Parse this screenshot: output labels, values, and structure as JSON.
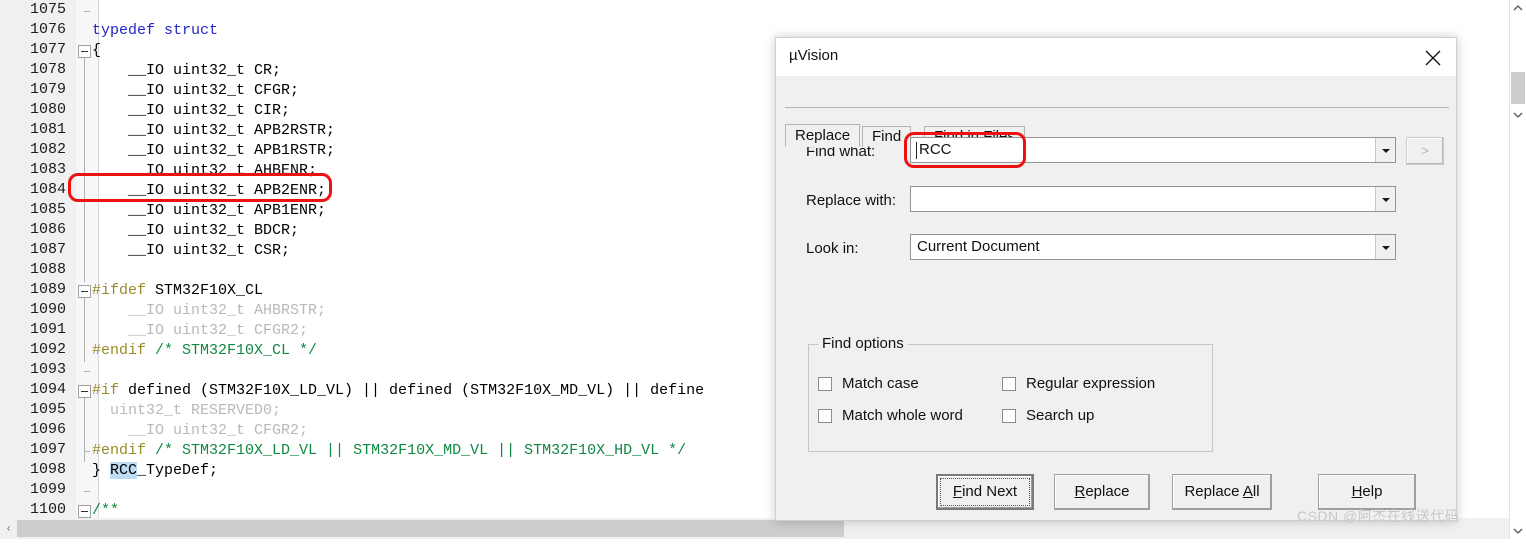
{
  "editor": {
    "lines": [
      {
        "num": "1075",
        "segments": [],
        "fold": "tick"
      },
      {
        "num": "1076",
        "segments": [
          {
            "t": "typedef struct",
            "c": "kw"
          }
        ]
      },
      {
        "num": "1077",
        "segments": [
          {
            "t": "{",
            "c": ""
          }
        ],
        "fold": "marker"
      },
      {
        "num": "1078",
        "segments": [
          {
            "t": "    __IO uint32_t CR;",
            "c": ""
          }
        ]
      },
      {
        "num": "1079",
        "segments": [
          {
            "t": "    __IO uint32_t CFGR;",
            "c": ""
          }
        ]
      },
      {
        "num": "1080",
        "segments": [
          {
            "t": "    __IO uint32_t CIR;",
            "c": ""
          }
        ]
      },
      {
        "num": "1081",
        "segments": [
          {
            "t": "    __IO uint32_t APB2RSTR;",
            "c": ""
          }
        ]
      },
      {
        "num": "1082",
        "segments": [
          {
            "t": "    __IO uint32_t APB1RSTR;",
            "c": ""
          }
        ]
      },
      {
        "num": "1083",
        "segments": [
          {
            "t": "    __IO uint32_t AHBENR;",
            "c": ""
          }
        ]
      },
      {
        "num": "1084",
        "segments": [
          {
            "t": "    __IO uint32_t APB2ENR;",
            "c": ""
          }
        ]
      },
      {
        "num": "1085",
        "segments": [
          {
            "t": "    __IO uint32_t APB1ENR;",
            "c": ""
          }
        ]
      },
      {
        "num": "1086",
        "segments": [
          {
            "t": "    __IO uint32_t BDCR;",
            "c": ""
          }
        ]
      },
      {
        "num": "1087",
        "segments": [
          {
            "t": "    __IO uint32_t CSR;",
            "c": ""
          }
        ]
      },
      {
        "num": "1088",
        "segments": []
      },
      {
        "num": "1089",
        "segments": [
          {
            "t": "#ifdef",
            "c": "pp"
          },
          {
            "t": " STM32F10X_CL",
            "c": ""
          }
        ],
        "fold": "marker"
      },
      {
        "num": "1090",
        "segments": [
          {
            "t": "    __IO uint32_t AHBRSTR;",
            "c": "dim"
          }
        ]
      },
      {
        "num": "1091",
        "segments": [
          {
            "t": "    __IO uint32_t CFGR2;",
            "c": "dim"
          }
        ]
      },
      {
        "num": "1092",
        "segments": [
          {
            "t": "#endif",
            "c": "pp"
          },
          {
            "t": " ",
            "c": ""
          },
          {
            "t": "/* STM32F10X_CL */",
            "c": "cm"
          }
        ]
      },
      {
        "num": "1093",
        "segments": [],
        "fold": "tick"
      },
      {
        "num": "1094",
        "segments": [
          {
            "t": "#if",
            "c": "pp"
          },
          {
            "t": " defined (STM32F10X_LD_VL) || defined (STM32F10X_MD_VL) || define",
            "c": ""
          }
        ],
        "fold": "marker"
      },
      {
        "num": "1095",
        "segments": [
          {
            "t": "  uint32_t RESERVED0;",
            "c": "dim"
          }
        ]
      },
      {
        "num": "1096",
        "segments": [
          {
            "t": "    __IO uint32_t CFGR2;",
            "c": "dim"
          }
        ]
      },
      {
        "num": "1097",
        "segments": [
          {
            "t": "#endif",
            "c": "pp"
          },
          {
            "t": " ",
            "c": ""
          },
          {
            "t": "/* STM32F10X_LD_VL || STM32F10X_MD_VL || STM32F10X_HD_VL */",
            "c": "cm"
          }
        ],
        "fold": "tick"
      },
      {
        "num": "1098",
        "segments": [
          {
            "t": "} ",
            "c": ""
          },
          {
            "t": "RCC",
            "c": "sel"
          },
          {
            "t": "_TypeDef;",
            "c": ""
          }
        ]
      },
      {
        "num": "1099",
        "segments": [],
        "fold": "tick"
      },
      {
        "num": "1100",
        "segments": [
          {
            "t": "/**",
            "c": "cm"
          }
        ],
        "fold": "marker"
      }
    ],
    "scrollbars": {
      "v_up": "▲",
      "v_down": "▼",
      "h_left": "‹"
    }
  },
  "dialog": {
    "title": "µVision",
    "close_label": "close-icon",
    "tabs": [
      {
        "label": "Replace",
        "active": true
      },
      {
        "label": "Find",
        "active": false
      },
      {
        "label": "Find in Files",
        "active": false
      }
    ],
    "fields": {
      "find_what_label": "Find what:",
      "find_what_value": "RCC",
      "replace_with_label": "Replace with:",
      "replace_with_value": "",
      "look_in_label": "Look in:",
      "look_in_value": "Current Document"
    },
    "arrow_button_label": ">",
    "find_options": {
      "group_label": "Find options",
      "checkboxes": [
        {
          "label": "Match case",
          "checked": false
        },
        {
          "label": "Regular expression",
          "checked": false
        },
        {
          "label": "Match whole word",
          "checked": false
        },
        {
          "label": "Search up",
          "checked": false
        }
      ]
    },
    "buttons": [
      {
        "label": "Find Next",
        "mnemonic": "F",
        "default": true
      },
      {
        "label": "Replace",
        "mnemonic": "R",
        "default": false
      },
      {
        "label": "Replace All",
        "mnemonic": "A",
        "default": false
      },
      {
        "label": "Help",
        "mnemonic": "H",
        "default": false
      }
    ]
  },
  "watermark": "CSDN @阿杰在线送代码",
  "colors": {
    "keyword": "#2424c8",
    "comment": "#118844",
    "preprocessor": "#9a8b2a",
    "inactive": "#b9b9b9",
    "selection": "#bfdcf5",
    "annotation": "#ee1111"
  }
}
